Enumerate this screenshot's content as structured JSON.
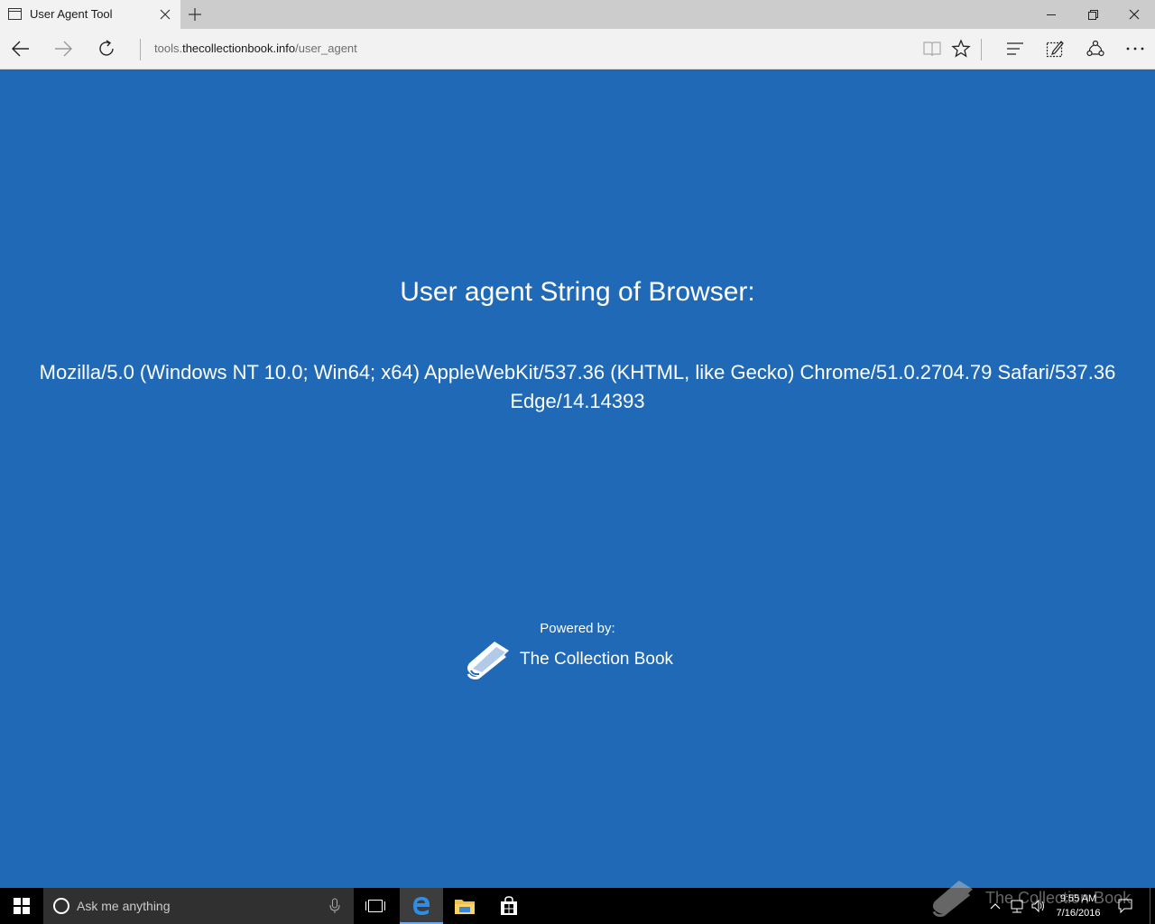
{
  "browser": {
    "tab": {
      "title": "User Agent Tool"
    },
    "address": {
      "prefix": "tools.",
      "host": "thecollectionbook.info",
      "path": "/user_agent"
    }
  },
  "page": {
    "heading": "User agent String of Browser:",
    "user_agent": "Mozilla/5.0 (Windows NT 10.0; Win64; x64) AppleWebKit/537.36 (KHTML, like Gecko) Chrome/51.0.2704.79 Safari/537.36 Edge/14.14393",
    "powered_by": "Powered by:",
    "brand": "The Collection Book",
    "background_color": "#1f69b6"
  },
  "taskbar": {
    "search_placeholder": "Ask me anything",
    "time": "9:55 AM",
    "date": "7/16/2016",
    "watermark": "The Collection Book"
  }
}
